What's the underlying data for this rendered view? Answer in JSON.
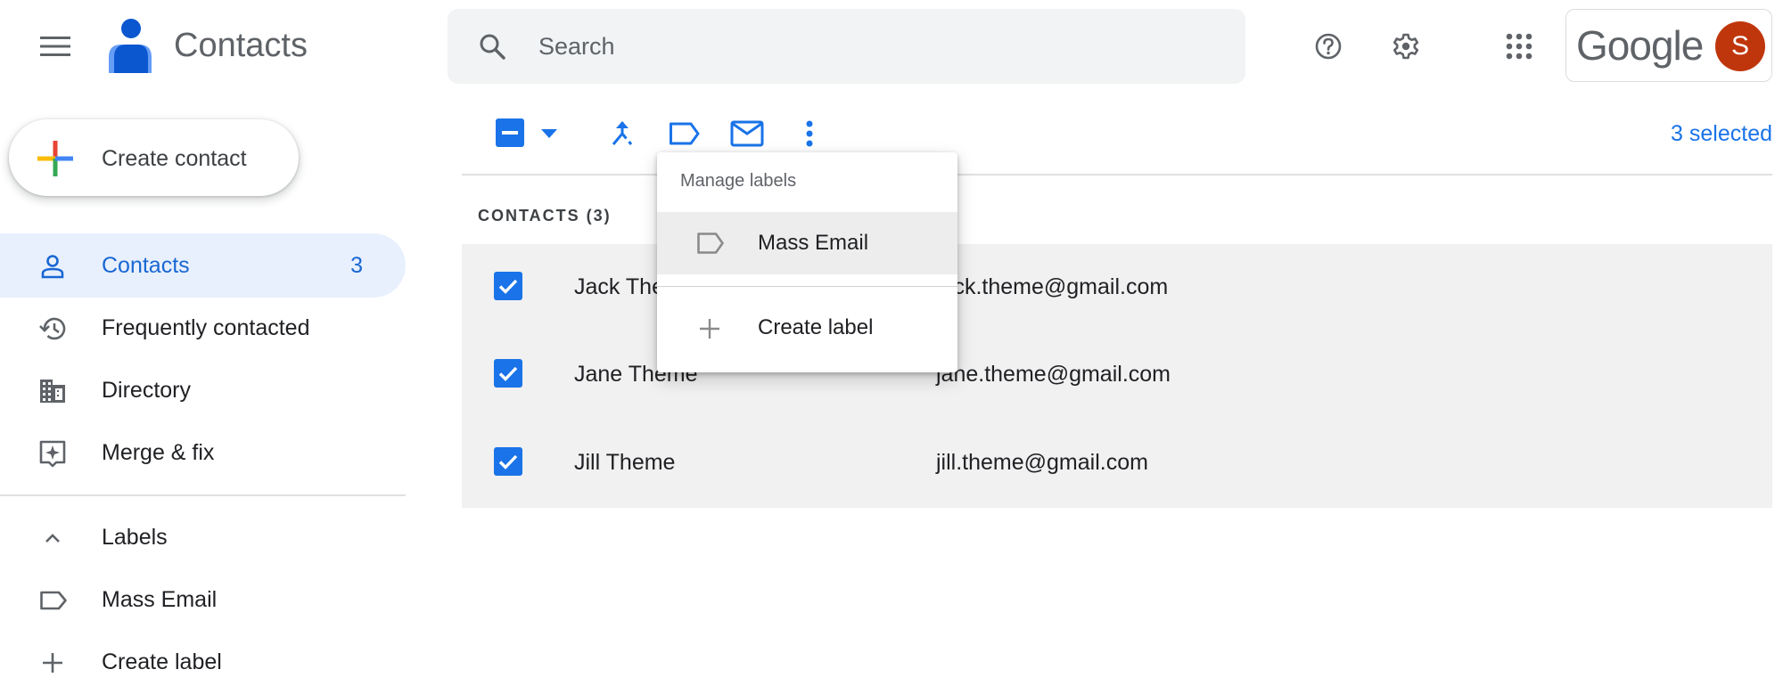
{
  "header": {
    "app_title": "Contacts",
    "search_placeholder": "Search",
    "search_value": "",
    "google_wordmark": "Google",
    "avatar_initial": "S",
    "avatar_color": "#bf360c"
  },
  "sidebar": {
    "create_contact_label": "Create contact",
    "items": [
      {
        "label": "Contacts",
        "count": "3",
        "icon": "person-icon",
        "active": true
      },
      {
        "label": "Frequently contacted",
        "icon": "history-icon"
      },
      {
        "label": "Directory",
        "icon": "building-icon"
      },
      {
        "label": "Merge & fix",
        "icon": "merge-fix-icon"
      }
    ],
    "labels_section": {
      "heading": "Labels",
      "expanded": true,
      "items": [
        {
          "label": "Mass Email",
          "icon": "label-icon"
        }
      ],
      "create_label": "Create label"
    }
  },
  "toolbar": {
    "selected_count_text": "3 selected",
    "select_state": "indeterminate",
    "accent_color": "#1a73e8"
  },
  "contacts": {
    "heading": "CONTACTS (3)",
    "rows": [
      {
        "name": "Jack Theme",
        "email": "jack.theme@gmail.com",
        "selected": true
      },
      {
        "name": "Jane Theme",
        "email": "jane.theme@gmail.com",
        "selected": true
      },
      {
        "name": "Jill Theme",
        "email": "jill.theme@gmail.com",
        "selected": true
      }
    ]
  },
  "labels_menu": {
    "heading": "Manage labels",
    "items": [
      {
        "label": "Mass Email",
        "icon": "label-icon",
        "highlighted": true
      }
    ],
    "create_label": "Create label"
  }
}
